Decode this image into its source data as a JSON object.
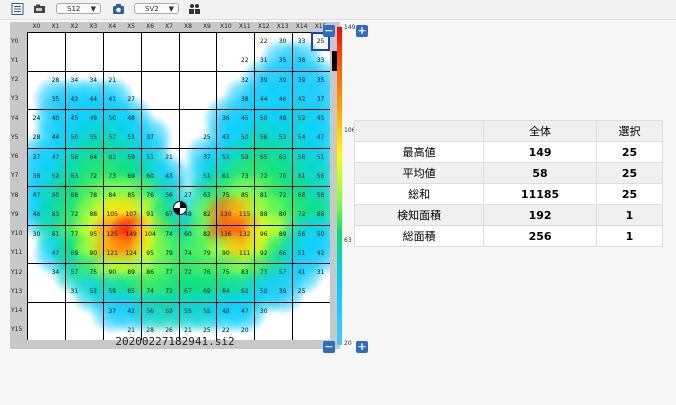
{
  "toolbar": {
    "select1": "S12",
    "select2": "SV2",
    "icons": [
      "list-icon",
      "camera-icon",
      "camera-icon",
      "people-icon"
    ]
  },
  "heatmap": {
    "columns": [
      "X0",
      "X1",
      "X2",
      "X3",
      "X4",
      "X5",
      "X6",
      "X7",
      "X8",
      "X9",
      "X10",
      "X11",
      "X12",
      "X13",
      "X14",
      "X15"
    ],
    "rows": [
      "Y0",
      "Y1",
      "Y2",
      "Y3",
      "Y4",
      "Y5",
      "Y6",
      "Y7",
      "Y8",
      "Y9",
      "Y10",
      "Y11",
      "Y12",
      "Y13",
      "Y14",
      "Y15"
    ],
    "values": [
      [
        null,
        null,
        null,
        null,
        null,
        null,
        null,
        null,
        null,
        null,
        null,
        null,
        22,
        30,
        33,
        25
      ],
      [
        null,
        null,
        null,
        null,
        null,
        null,
        null,
        null,
        null,
        null,
        null,
        22,
        31,
        35,
        36,
        33
      ],
      [
        null,
        28,
        34,
        34,
        21,
        null,
        null,
        null,
        null,
        null,
        null,
        32,
        39,
        39,
        39,
        35
      ],
      [
        null,
        35,
        42,
        44,
        41,
        27,
        null,
        null,
        null,
        null,
        null,
        38,
        44,
        46,
        42,
        37
      ],
      [
        24,
        40,
        45,
        49,
        50,
        48,
        null,
        null,
        null,
        null,
        36,
        45,
        50,
        48,
        52,
        45
      ],
      [
        28,
        44,
        50,
        55,
        57,
        51,
        37,
        null,
        null,
        25,
        43,
        50,
        58,
        53,
        54,
        47
      ],
      [
        37,
        47,
        56,
        64,
        63,
        59,
        51,
        21,
        null,
        37,
        51,
        59,
        65,
        63,
        56,
        51
      ],
      [
        38,
        52,
        63,
        72,
        73,
        69,
        60,
        43,
        null,
        51,
        61,
        73,
        72,
        70,
        61,
        56
      ],
      [
        47,
        60,
        68,
        78,
        84,
        85,
        76,
        56,
        27,
        63,
        75,
        85,
        81,
        72,
        66,
        58
      ],
      [
        46,
        63,
        72,
        88,
        105,
        107,
        91,
        67,
        48,
        82,
        130,
        115,
        88,
        80,
        72,
        66
      ],
      [
        30,
        61,
        77,
        95,
        125,
        149,
        104,
        74,
        60,
        82,
        136,
        132,
        96,
        89,
        56,
        50
      ],
      [
        null,
        47,
        69,
        90,
        121,
        124,
        95,
        79,
        74,
        79,
        90,
        111,
        92,
        66,
        51,
        42
      ],
      [
        null,
        34,
        57,
        75,
        90,
        89,
        86,
        77,
        72,
        76,
        75,
        83,
        73,
        57,
        41,
        31
      ],
      [
        null,
        null,
        31,
        52,
        59,
        65,
        74,
        72,
        67,
        69,
        64,
        62,
        50,
        39,
        25,
        null
      ],
      [
        null,
        null,
        null,
        null,
        37,
        42,
        56,
        59,
        55,
        55,
        48,
        47,
        30,
        null,
        null,
        null
      ],
      [
        null,
        null,
        null,
        null,
        null,
        21,
        28,
        26,
        21,
        25,
        22,
        20,
        null,
        null,
        null,
        null
      ]
    ],
    "filename": "20200227182941.si2",
    "selected": {
      "row": 0,
      "col": 15
    }
  },
  "scale": {
    "max": "149",
    "mid": "106",
    "low": "63",
    "min": "20"
  },
  "stats": {
    "headers": [
      "",
      "全体",
      "選択"
    ],
    "rows": [
      {
        "label": "最高値",
        "total": "149",
        "selection": "25"
      },
      {
        "label": "平均値",
        "total": "58",
        "selection": "25"
      },
      {
        "label": "総和",
        "total": "11185",
        "selection": "25"
      },
      {
        "label": "検知面積",
        "total": "192",
        "selection": "1"
      },
      {
        "label": "総面積",
        "total": "256",
        "selection": "1"
      }
    ]
  }
}
